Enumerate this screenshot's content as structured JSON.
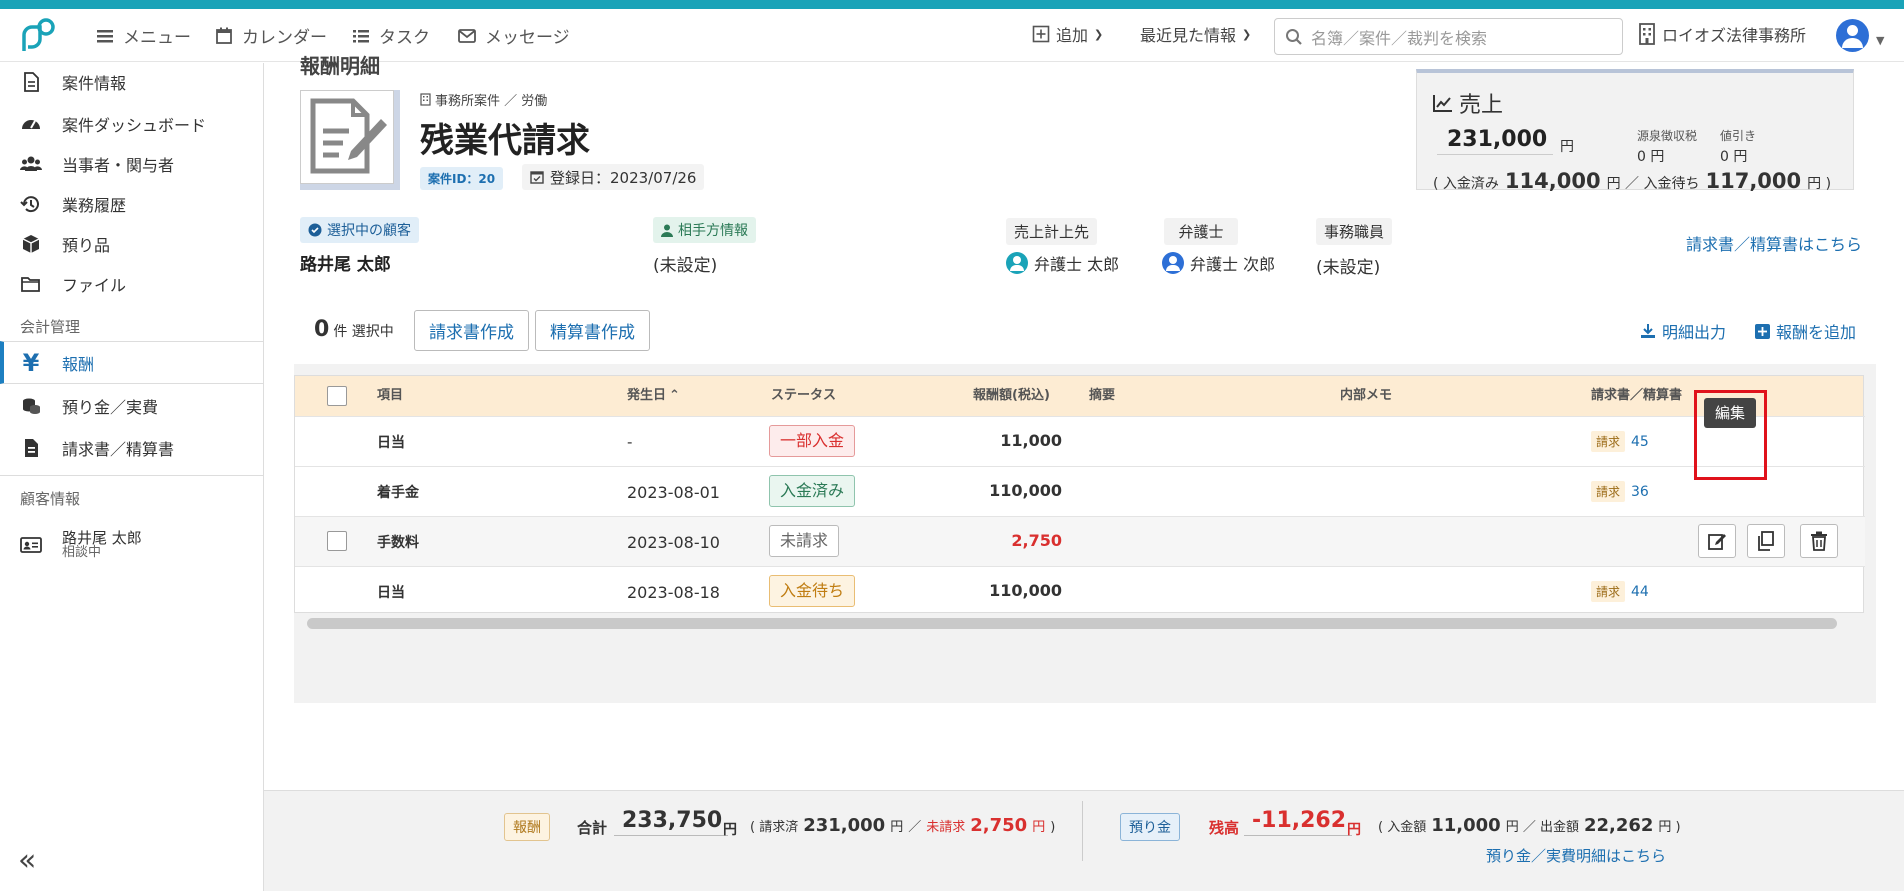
{
  "header": {
    "menu": "メニュー",
    "calendar": "カレンダー",
    "task": "タスク",
    "message": "メッセージ",
    "add": "追加",
    "recent": "最近見た情報",
    "search_placeholder": "名簿／案件／裁判を検索",
    "firm": "ロイオズ法律事務所"
  },
  "sidebar": {
    "items": [
      {
        "label": "案件情報",
        "icon": "document-icon"
      },
      {
        "label": "案件ダッシュボード",
        "icon": "dashboard-icon"
      },
      {
        "label": "当事者・関与者",
        "icon": "people-icon"
      },
      {
        "label": "業務履歴",
        "icon": "history-icon"
      },
      {
        "label": "預り品",
        "icon": "box-icon"
      },
      {
        "label": "ファイル",
        "icon": "folder-icon"
      }
    ],
    "section_accounting": "会計管理",
    "accounting": [
      {
        "label": "報酬",
        "icon": "yen-icon"
      },
      {
        "label": "預り金／実費",
        "icon": "coins-icon"
      },
      {
        "label": "請求書／精算書",
        "icon": "invoice-icon"
      }
    ],
    "section_client": "顧客情報",
    "client_name": "路井尾 太郎",
    "client_status": "相談中"
  },
  "page": {
    "title_partial": "報酬明細",
    "breadcrumb": "事務所案件 ／ 労働",
    "case_title": "残業代請求",
    "case_id": "案件ID：20",
    "registered": "登録日：2023/07/26"
  },
  "parties": {
    "client_label": "選択中の顧客",
    "client_name": "路井尾 太郎",
    "opponent_label": "相手方情報",
    "opponent_value": "(未設定)",
    "sales_label": "売上計上先",
    "sales_value": "弁護士 太郎",
    "lawyer_label": "弁護士",
    "lawyer_value": "弁護士 次郎",
    "staff_label": "事務職員",
    "staff_value": "(未設定)"
  },
  "sales": {
    "title": "売上",
    "amount": "231,000",
    "yen": "円",
    "withholding_label": "源泉徴収税",
    "withholding_value": "0 円",
    "discount_label": "値引き",
    "discount_value": "0 円",
    "paid_label": "( 入金済み",
    "paid_value": "114,000",
    "waiting_label": "円 ／ 入金待ち",
    "waiting_value": "117,000",
    "waiting_suffix": "円 )",
    "invoice_link": "請求書／精算書はこちら"
  },
  "actions": {
    "selected_count": "0",
    "selected_label": "件 選択中",
    "create_invoice": "請求書作成",
    "create_settlement": "精算書作成",
    "export": "明細出力",
    "add_fee": "報酬を追加"
  },
  "table": {
    "headers": [
      "項目",
      "発生日",
      "ステータス",
      "報酬額(税込)",
      "摘要",
      "内部メモ",
      "請求書／精算書"
    ],
    "rows": [
      {
        "item": "日当",
        "date": "-",
        "status": "一部入金",
        "amount": "11,000",
        "bill_tag": "請求",
        "bill_no": "45"
      },
      {
        "item": "着手金",
        "date": "2023-08-01",
        "status": "入金済み",
        "amount": "110,000",
        "bill_tag": "請求",
        "bill_no": "36"
      },
      {
        "item": "手数料",
        "date": "2023-08-10",
        "status": "未請求",
        "amount": "2,750",
        "bill_tag": "",
        "bill_no": ""
      },
      {
        "item": "日当",
        "date": "2023-08-18",
        "status": "入金待ち",
        "amount": "110,000",
        "bill_tag": "請求",
        "bill_no": "44"
      }
    ],
    "tooltip": "編集"
  },
  "footer": {
    "fee_tag": "報酬",
    "total_label": "合計",
    "total_value": "233,750",
    "yen": "円",
    "billed_label": "( 請求済",
    "billed_value": "231,000",
    "unbilled_label": "未請求",
    "unbilled_value": "2,750",
    "deposit_tag": "預り金",
    "balance_label": "残高",
    "balance_value": "-11,262",
    "in_label": "( 入金額",
    "in_value": "11,000",
    "out_label": "円 ／ 出金額",
    "out_value": "22,262",
    "close": "円 )",
    "deposit_link": "預り金／実費明細はこちら"
  },
  "colors": {
    "accent": "#1d6fb0",
    "teal": "#1aa3b8",
    "red": "#d9302f"
  }
}
